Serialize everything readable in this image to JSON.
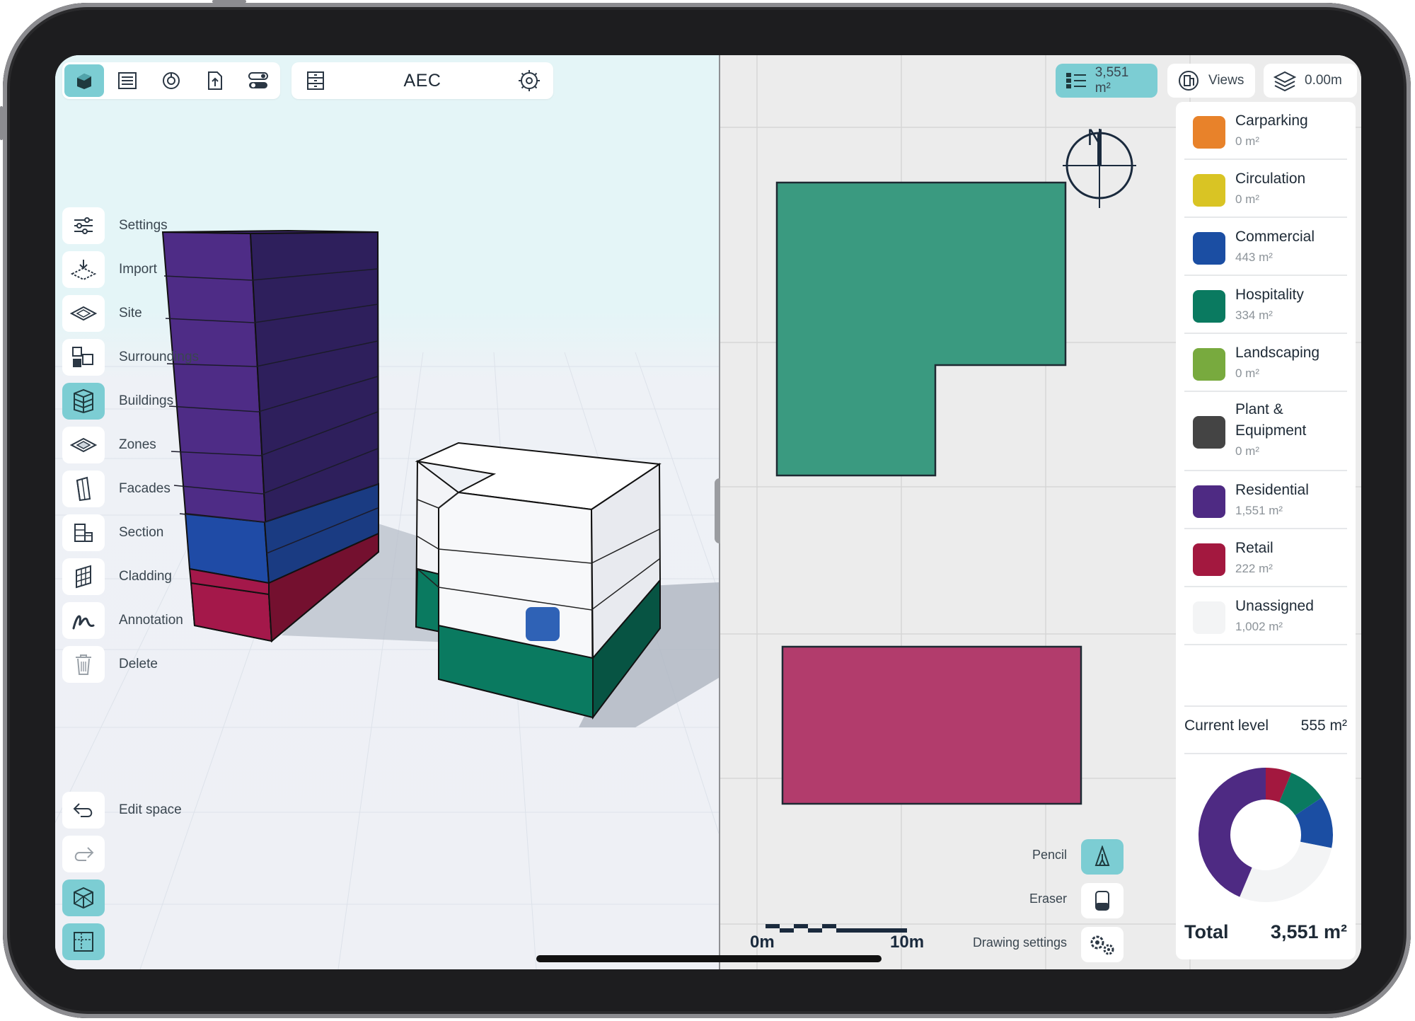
{
  "toolbar": {
    "title": "AEC",
    "buttons": [
      "cube-icon",
      "list-icon",
      "chart-icon",
      "export-icon",
      "toggles-icon",
      "cabinet-icon",
      "gear-icon"
    ]
  },
  "side_menu": {
    "items": [
      {
        "label": "Settings",
        "icon": "sliders-icon",
        "active": false
      },
      {
        "label": "Import",
        "icon": "import-icon",
        "active": false
      },
      {
        "label": "Site",
        "icon": "site-icon",
        "active": false
      },
      {
        "label": "Surroundings",
        "icon": "surroundings-icon",
        "active": false
      },
      {
        "label": "Buildings",
        "icon": "building-icon",
        "active": true
      },
      {
        "label": "Zones",
        "icon": "zones-icon",
        "active": false
      },
      {
        "label": "Facades",
        "icon": "facade-icon",
        "active": false
      },
      {
        "label": "Section",
        "icon": "section-icon",
        "active": false
      },
      {
        "label": "Cladding",
        "icon": "cladding-icon",
        "active": false
      },
      {
        "label": "Annotation",
        "icon": "annotation-icon",
        "active": false
      },
      {
        "label": "Delete",
        "icon": "trash-icon",
        "active": false
      }
    ],
    "edit_space": "Edit space"
  },
  "top_right": {
    "area_label": "3,551 m²",
    "views_label": "Views",
    "level_label": "0.00m"
  },
  "compass": {
    "label": "N"
  },
  "legend": {
    "items": [
      {
        "name": "Carparking",
        "value": "0 m²",
        "color": "#e8822a"
      },
      {
        "name": "Circulation",
        "value": "0 m²",
        "color": "#d9c424"
      },
      {
        "name": "Commercial",
        "value": "443 m²",
        "color": "#1b4ea3"
      },
      {
        "name": "Hospitality",
        "value": "334 m²",
        "color": "#0a7a60"
      },
      {
        "name": "Landscaping",
        "value": "0 m²",
        "color": "#78aa3e"
      },
      {
        "name": "Plant &\nEquipment",
        "value": "0 m²",
        "color": "#444444"
      },
      {
        "name": "Residential",
        "value": "1,551 m²",
        "color": "#4e2a83"
      },
      {
        "name": "Retail",
        "value": "222 m²",
        "color": "#a3183f"
      },
      {
        "name": "Unassigned",
        "value": "1,002 m²",
        "color": "#f3f4f5"
      }
    ],
    "current_level_label": "Current level",
    "current_level_value": "555 m²",
    "total_label": "Total",
    "total_value": "3,551 m²"
  },
  "donut": {
    "segments": [
      {
        "name": "Retail",
        "value": 222,
        "color": "#a3183f"
      },
      {
        "name": "Hospitality",
        "value": 334,
        "color": "#0a7a60"
      },
      {
        "name": "Commercial",
        "value": 443,
        "color": "#1b4ea3"
      },
      {
        "name": "Unassigned",
        "value": 1002,
        "color": "#f3f4f5"
      },
      {
        "name": "Residential",
        "value": 1551,
        "color": "#4e2a83"
      }
    ]
  },
  "drawing_tools": {
    "pencil": "Pencil",
    "eraser": "Eraser",
    "settings": "Drawing settings"
  },
  "scale_bar": {
    "start": "0m",
    "end": "10m"
  }
}
